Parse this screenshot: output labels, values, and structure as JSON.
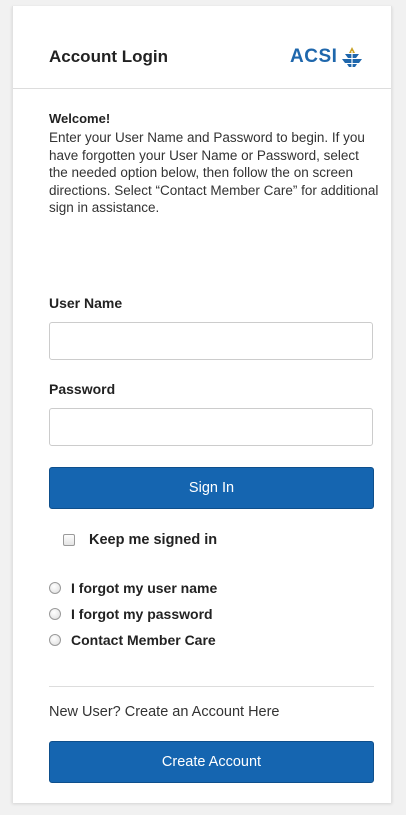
{
  "header": {
    "title": "Account Login",
    "logo_text": "ACSI"
  },
  "intro": {
    "heading": "Welcome!",
    "text": "Enter your User Name and Password to begin. If you have forgotten your User Name or Password, select the needed option below, then follow the on screen directions. Select “Contact Member Care” for additional sign in assistance."
  },
  "form": {
    "username_label": "User Name",
    "username_value": "",
    "username_placeholder": "",
    "password_label": "Password",
    "password_value": "",
    "password_placeholder": "",
    "sign_in_label": "Sign In",
    "keep_signed_in_label": "Keep me signed in",
    "keep_signed_in_checked": false
  },
  "recovery_options": [
    {
      "label": "I forgot my user name",
      "selected": false
    },
    {
      "label": "I forgot my password",
      "selected": false
    },
    {
      "label": "Contact Member Care",
      "selected": false
    }
  ],
  "footer": {
    "new_user_text": "New User? Create an Account Here",
    "create_account_label": "Create Account"
  },
  "colors": {
    "primary_button": "#1565b0",
    "logo_blue": "#1f67ac",
    "logo_gold": "#c9a227"
  },
  "icons": {
    "logo_mark": "acsi-torch-logo-icon"
  }
}
